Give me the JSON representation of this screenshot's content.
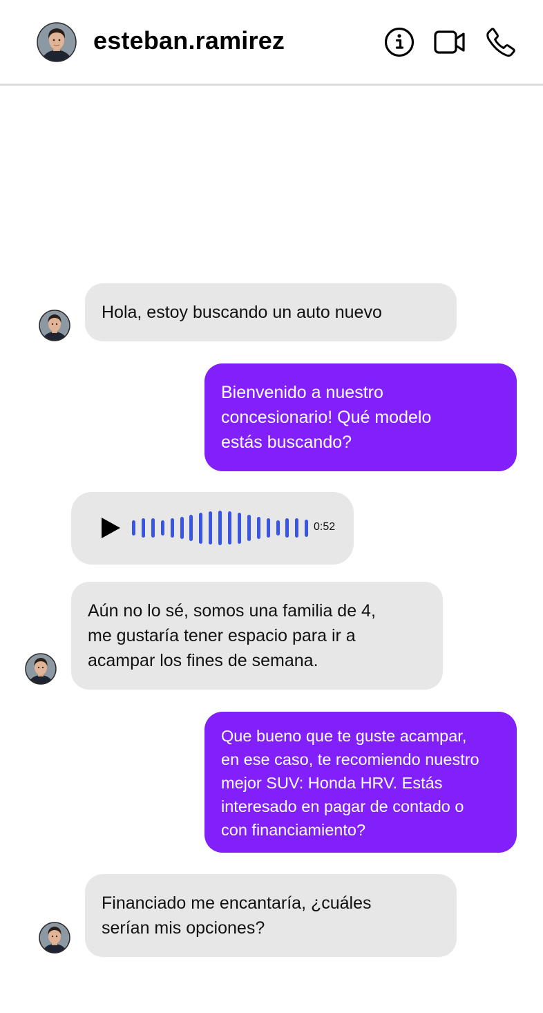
{
  "header": {
    "username": "esteban.ramirez",
    "icons": [
      "info-icon",
      "video-call-icon",
      "phone-icon"
    ]
  },
  "colors": {
    "outgoing_bubble": "#8220fb",
    "incoming_bubble": "#e7e7e7",
    "waveform": "#3a55e0",
    "divider": "#dcdcdc"
  },
  "messages": {
    "m1": {
      "text": "Hola, estoy buscando un auto nuevo"
    },
    "m2": {
      "text": "Bienvenido a nuestro\nconcesionario! Qué modelo\nestás buscando?"
    },
    "voice": {
      "duration": "0:52",
      "waveform_levels": [
        0.45,
        0.55,
        0.55,
        0.45,
        0.55,
        0.65,
        0.75,
        0.9,
        0.95,
        1.0,
        0.95,
        0.9,
        0.75,
        0.65,
        0.55,
        0.45,
        0.55,
        0.55,
        0.5
      ]
    },
    "m3": {
      "text": "Aún no lo sé, somos una familia de 4,\nme gustaría tener espacio para ir a\nacampar los fines de semana."
    },
    "m4": {
      "text": "Que bueno que te guste acampar,\nen ese caso, te recomiendo nuestro\nmejor SUV: Honda HRV. Estás\ninteresado en pagar de contado o\ncon financiamiento?"
    },
    "m5": {
      "text": "Financiado me encantaría, ¿cuáles\nserían mis opciones?"
    }
  }
}
